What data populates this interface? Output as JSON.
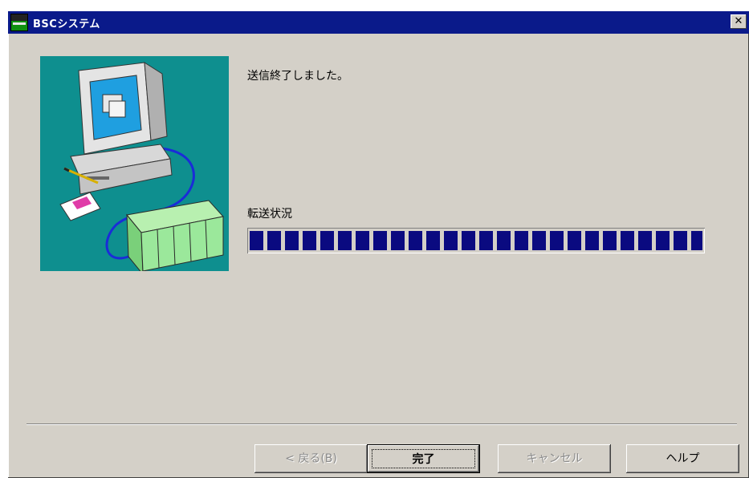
{
  "window": {
    "title": "BSCシステム",
    "close_glyph": "✕"
  },
  "main": {
    "message": "送信終了しました。",
    "transfer_label": "転送状況",
    "progress": {
      "percent": 100,
      "bar_color": "#0a0a80"
    }
  },
  "buttons": {
    "back": "< 戻る(B)",
    "finish": "完了",
    "cancel": "キャンセル",
    "help": "ヘルプ"
  },
  "colors": {
    "titlebar": "#0a1a8a",
    "dialog_bg": "#d4d0c8",
    "illustration_bg": "#0e8f8f"
  },
  "icons": {
    "app": "app-icon",
    "close": "close-icon",
    "illustration": "computer-transfer-illustration"
  }
}
